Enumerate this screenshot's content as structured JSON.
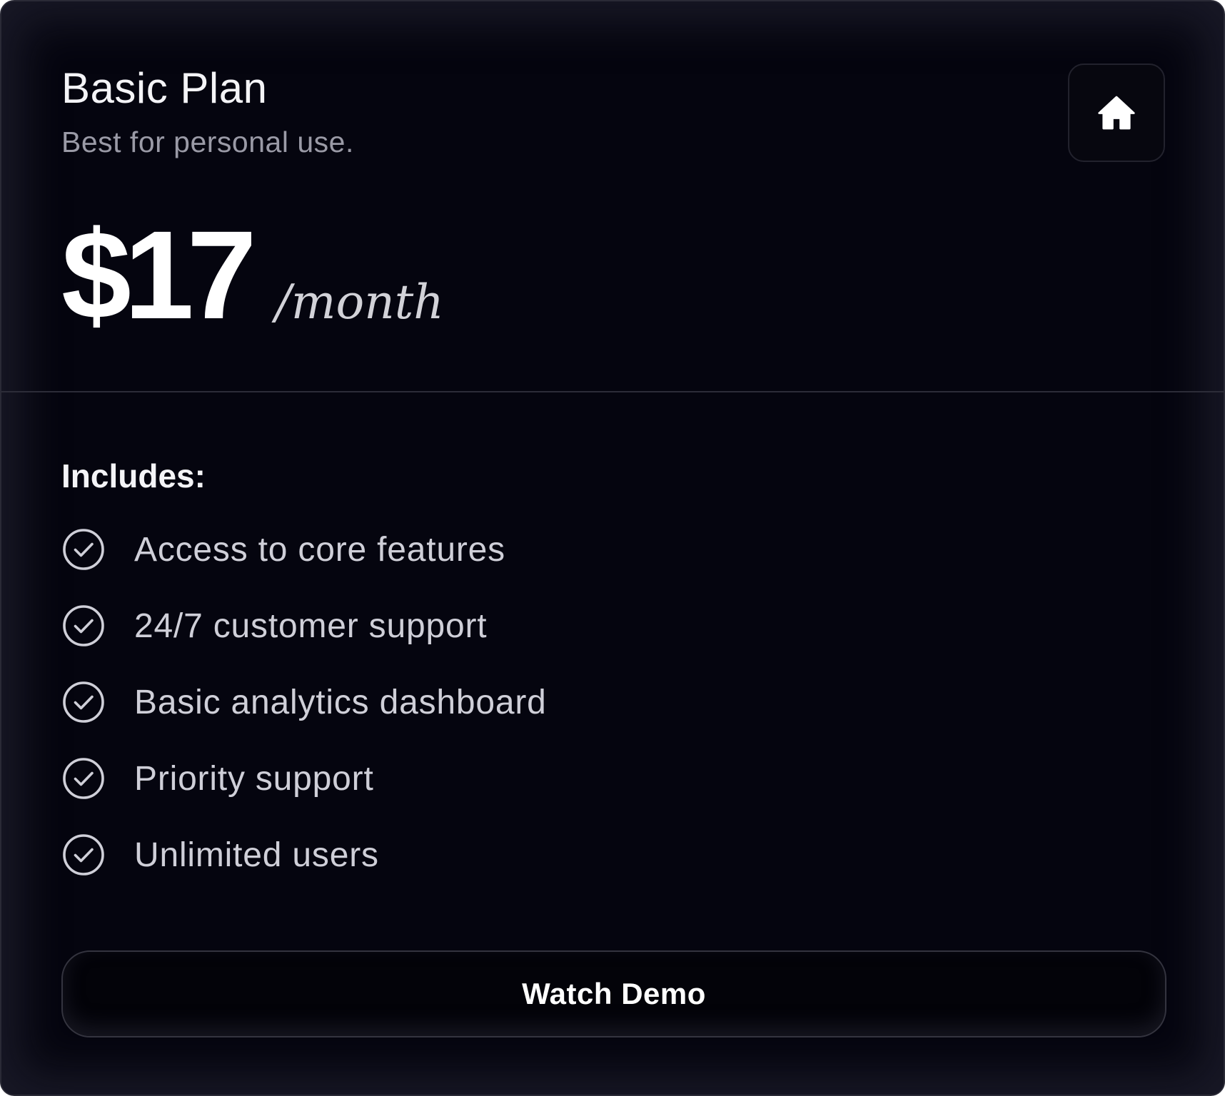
{
  "plan": {
    "title": "Basic Plan",
    "subtitle": "Best for personal use.",
    "icon": "home-icon"
  },
  "price": {
    "amount": "$17",
    "period": "/month"
  },
  "includes": {
    "label": "Includes:",
    "check_icon": "check-circle-icon",
    "features": [
      "Access to core features",
      "24/7 customer support",
      "Basic analytics dashboard",
      "Priority support",
      "Unlimited users"
    ]
  },
  "cta": {
    "label": "Watch Demo"
  },
  "colors": {
    "background": "#05050f",
    "text_primary": "#f4f4f7",
    "text_secondary": "#9a9aa6",
    "feature_text": "#cfcfd8",
    "border": "#2c2c38"
  }
}
